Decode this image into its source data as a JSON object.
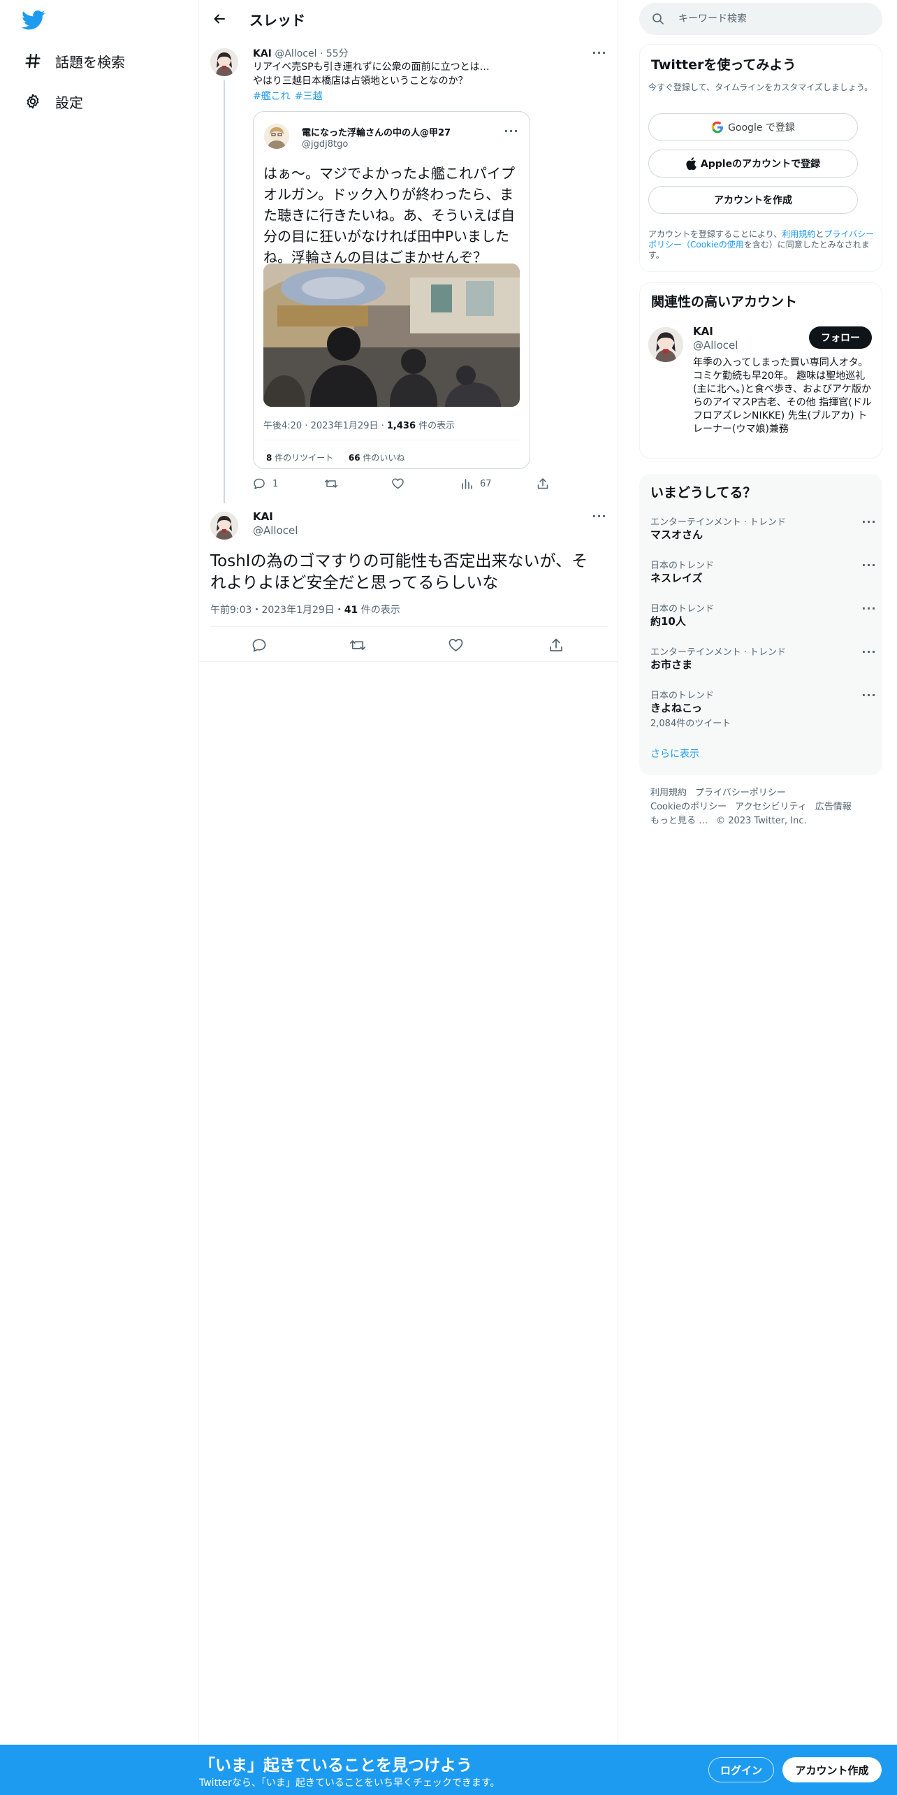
{
  "nav": {
    "items": [
      {
        "label": "話題を検索",
        "icon": "hashtag-icon"
      },
      {
        "label": "設定",
        "icon": "gear-icon"
      }
    ]
  },
  "header": {
    "title": "スレッド"
  },
  "tweet1": {
    "name": "KAI",
    "handle": "@Allocel",
    "time": "55分",
    "text_line1": "リアイベ売SPも引き連れずに公衆の面前に立つとは…",
    "text_line2": "やはり三越日本橋店は占領地ということなのか？",
    "hashtags": [
      "#艦これ",
      "#三越"
    ],
    "quote": {
      "name": "電になった浮輪さんの中の人@甲27",
      "handle": "@jgdj8tgo",
      "text": "はぁ～。マジでよかったよ艦これパイプオルガン。ドック入りが終わったら、また聴きに行きたいね。あ、そういえば自分の目に狂いがなければ田中Pいましたね。浮輪さんの目はごまかせんぞ？",
      "time": "午後4:20 · 2023年1月29日 · ",
      "views_count": "1,436",
      "views_label": " 件の表示",
      "retweets_count": "8",
      "retweets_label": " 件のリツイート",
      "likes_count": "66",
      "likes_label": " 件のいいね"
    },
    "actions": {
      "reply_count": "1",
      "views_count": "67"
    }
  },
  "tweet2": {
    "name": "KAI",
    "handle": "@Allocel",
    "text": "ToshIの為のゴマすりの可能性も否定出来ないが、それよりよほど安全だと思ってるらしいな",
    "time": "午前9:03・2023年1月29日・",
    "views_count": "41",
    "views_label": " 件の表示"
  },
  "search": {
    "placeholder": "キーワード検索"
  },
  "signup_card": {
    "title": "Twitterを使ってみよう",
    "subtitle": "今すぐ登録して、タイムラインをカスタマイズしましょう。",
    "google_button": "Google で登録",
    "apple_button": "Appleのアカウントで登録",
    "create_button": "アカウントを作成",
    "terms_prefix": "アカウントを登録することにより、",
    "terms_link": "利用規約",
    "terms_and": "と",
    "privacy_link": "プライバシーポリシー",
    "cookie_link": "（Cookieの使用",
    "terms_suffix": "を含む）に同意したとみなされます。"
  },
  "related_card": {
    "title": "関連性の高いアカウント",
    "name": "KAI",
    "handle": "@Allocel",
    "follow_button": "フォロー",
    "bio": "年季の入ってしまった買い専同人オタ。コミケ勤続も早20年。 趣味は聖地巡礼(主に北へ。)と食べ歩き、およびアケ版からのアイマスP古老、その他 指揮官(ドルフロアズレンNIKKE) 先生(ブルアカ) トレーナー(ウマ娘)兼務"
  },
  "trends_card": {
    "title": "いまどうしてる？",
    "trends": [
      {
        "category": "エンターテインメント · トレンド",
        "name": "マスオさん"
      },
      {
        "category": "日本のトレンド",
        "name": "ネスレイズ"
      },
      {
        "category": "日本のトレンド",
        "name": "約10人"
      },
      {
        "category": "エンターテインメント · トレンド",
        "name": "お市さま"
      },
      {
        "category": "日本のトレンド",
        "name": "きよねこっ",
        "count": "2,084件のツイート"
      }
    ],
    "show_more": "さらに表示"
  },
  "footer": {
    "terms": "利用規約",
    "privacy": "プライバシーポリシー",
    "cookie": "Cookieのポリシー",
    "accessibility": "アクセシビリティ",
    "ads": "広告情報",
    "more": "もっと見る …",
    "copyright": "© 2023 Twitter, Inc."
  },
  "bottom_bar": {
    "title": "「いま」起きていることを見つけよう",
    "subtitle": "Twitterなら、「いま」起きていることをいち早くチェックできます。",
    "login": "ログイン",
    "signup": "アカウント作成"
  },
  "colors": {
    "accent": "#1d9bf0",
    "text": "#0f1419",
    "muted": "#536471",
    "border": "#eff3f4"
  }
}
